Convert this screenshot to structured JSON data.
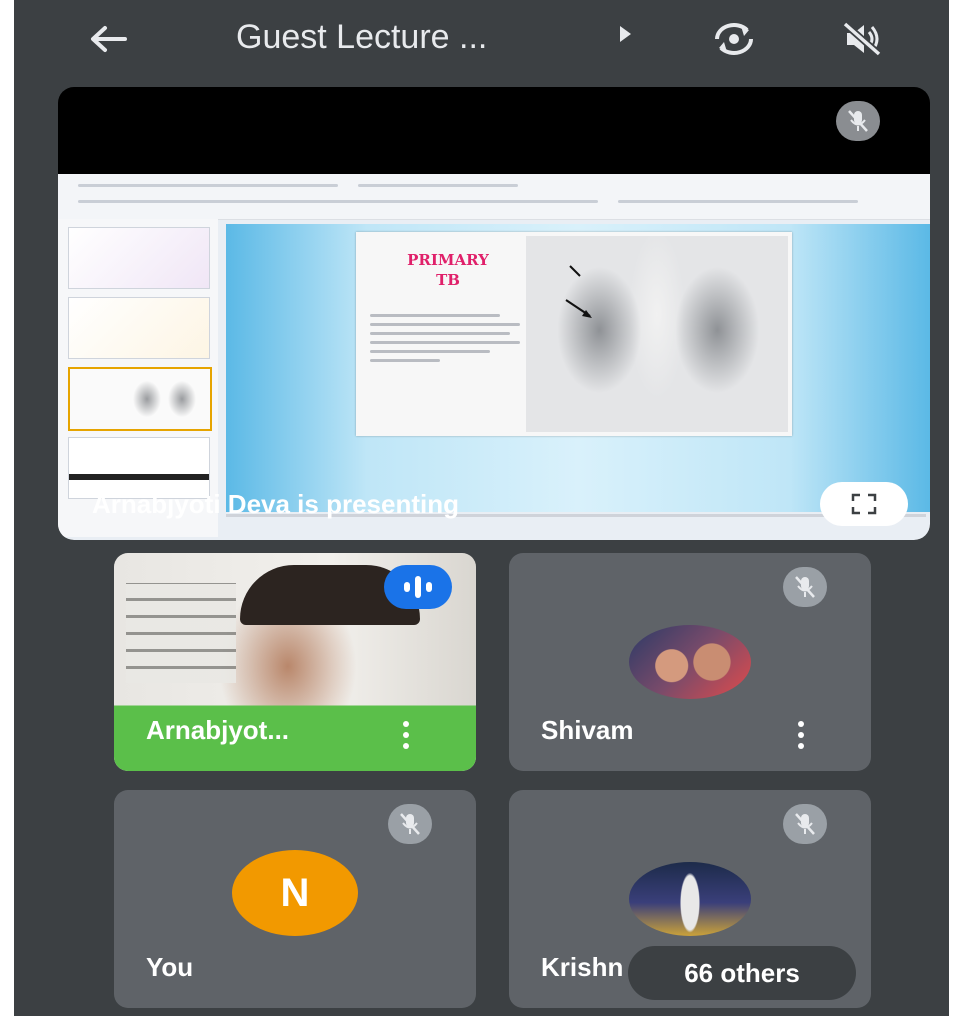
{
  "header": {
    "title": "Guest Lecture ...",
    "back_icon": "arrow-left-icon",
    "caret_icon": "caret-right-icon",
    "switch_camera_icon": "switch-camera-icon",
    "speaker_icon": "speaker-off-icon"
  },
  "presentation": {
    "label": "Arnabjyoti Deva is presenting",
    "slide_title": "PRIMARY\nTB",
    "fullscreen_icon": "fullscreen-icon",
    "mic_icon": "mic-off-icon"
  },
  "participants": [
    {
      "name": "Arnabjyot...",
      "state": "speaking",
      "video": true
    },
    {
      "name": "Shivam",
      "state": "muted",
      "video": false
    },
    {
      "name": "You",
      "state": "muted",
      "avatar_letter": "N",
      "video": false
    },
    {
      "name": "Krishn",
      "state": "muted",
      "video": false
    }
  ],
  "others": {
    "label": "66 others"
  },
  "colors": {
    "background": "#3c4043",
    "tile": "#5f6368",
    "speaking": "#1a73e8",
    "avatar_you": "#f29900",
    "slide_title": "#e0206a"
  }
}
